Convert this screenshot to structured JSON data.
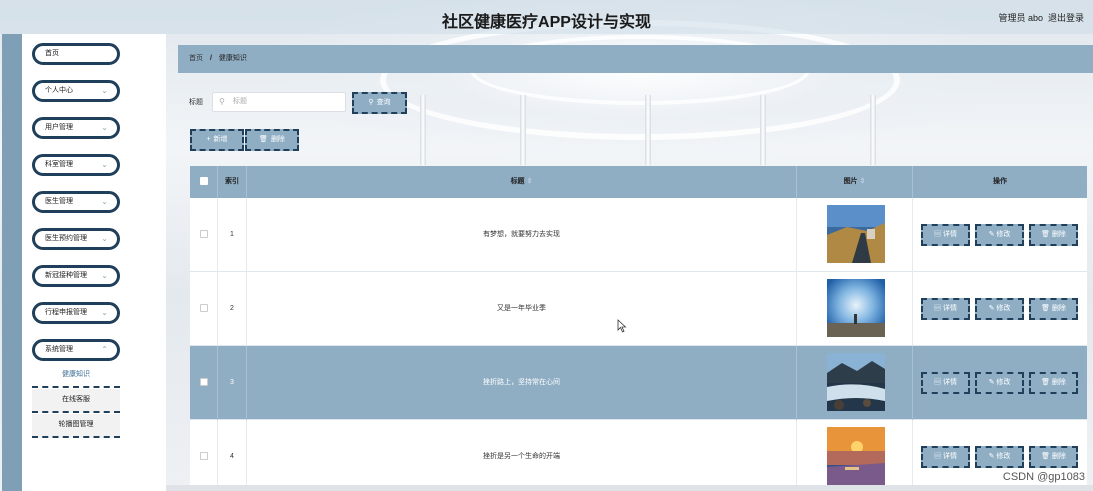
{
  "app": {
    "title": "社区健康医疗APP设计与实现",
    "user": "管理员 abo",
    "logout": "退出登录"
  },
  "sidebar": {
    "items": [
      {
        "label": "首页",
        "chevron": false
      },
      {
        "label": "个人中心",
        "chevron": true
      },
      {
        "label": "用户管理",
        "chevron": true
      },
      {
        "label": "科室管理",
        "chevron": true
      },
      {
        "label": "医生管理",
        "chevron": true
      },
      {
        "label": "医生预约管理",
        "chevron": true
      },
      {
        "label": "新冠接种管理",
        "chevron": true
      },
      {
        "label": "行程申报管理",
        "chevron": true
      },
      {
        "label": "系统管理",
        "chevron": true
      }
    ],
    "submenu": [
      {
        "label": "健康知识",
        "active": true
      },
      {
        "label": "在线客服",
        "active": false
      },
      {
        "label": "轮播图管理",
        "active": false
      }
    ]
  },
  "breadcrumb": {
    "home": "首页",
    "separator": "/",
    "current": "健康知识"
  },
  "search": {
    "label": "标题",
    "placeholder": "标题",
    "button": "查询"
  },
  "toolbar": {
    "add": "新增",
    "delete": "删除"
  },
  "table": {
    "headers": {
      "index": "索引",
      "title": "标题",
      "image": "图片",
      "actions": "操作"
    },
    "rows": [
      {
        "index": "1",
        "title": "有梦想，就要努力去实现",
        "image": "road-landscape-photo",
        "highlighted": false
      },
      {
        "index": "2",
        "title": "又是一年毕业季",
        "image": "blue-sky-person-photo",
        "highlighted": false
      },
      {
        "index": "3",
        "title": "挫折路上，坚持常在心间",
        "image": "river-rocks-photo",
        "highlighted": true
      },
      {
        "index": "4",
        "title": "挫折是另一个生命的开端",
        "image": "sunset-harbor-photo",
        "highlighted": false
      }
    ],
    "row_actions": {
      "detail": "详情",
      "edit": "修改",
      "delete": "删除"
    }
  },
  "watermark": "CSDN @gp1083",
  "colors": {
    "accent": "#8faec4",
    "border_dark": "#1f3f5a",
    "rail": "#7f9fb6"
  }
}
